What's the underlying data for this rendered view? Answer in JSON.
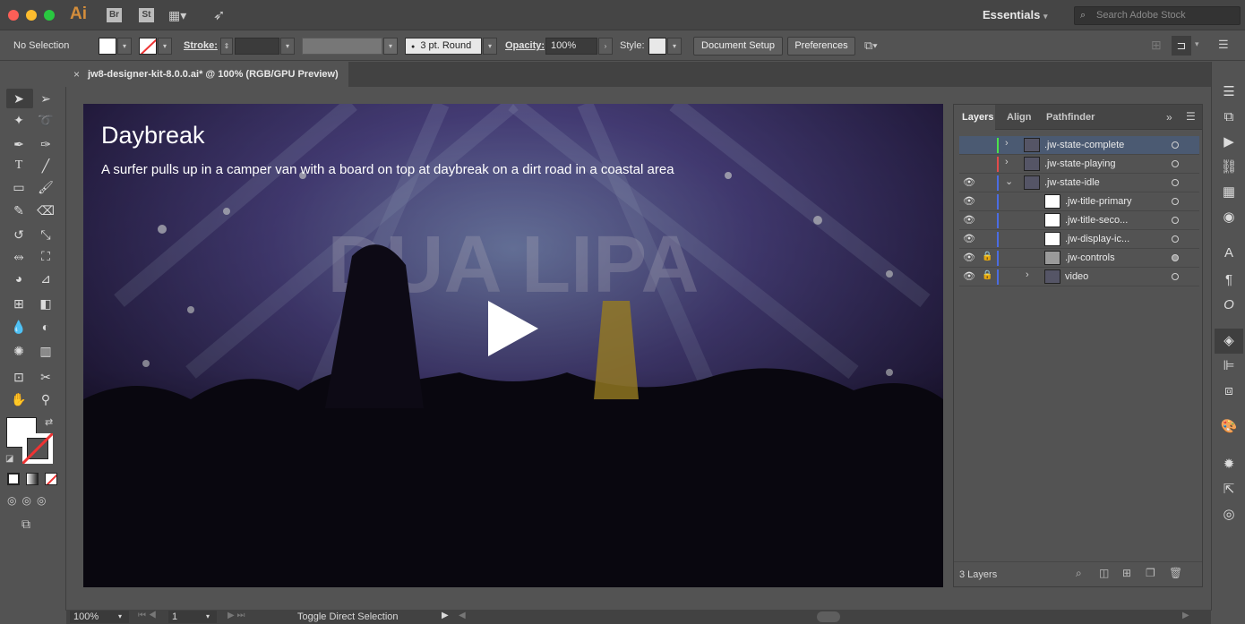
{
  "appbar": {
    "logo": "Ai",
    "bridge": "Br",
    "stock": "St",
    "workspace": "Essentials",
    "search_placeholder": "Search Adobe Stock"
  },
  "control": {
    "selection": "No Selection",
    "stroke_label": "Stroke:",
    "brush": "3 pt. Round",
    "opacity_label": "Opacity:",
    "opacity_value": "100%",
    "style_label": "Style:",
    "document_setup": "Document Setup",
    "preferences": "Preferences"
  },
  "document": {
    "tab_title": "jw8-designer-kit-8.0.0.ai* @ 100% (RGB/GPU Preview)",
    "close": "×"
  },
  "video": {
    "title": "Daybreak",
    "description": "A surfer pulls up in a camper van with a board on top at daybreak on a dirt road in a coastal area"
  },
  "layers_panel": {
    "tabs": [
      "Layers",
      "Align",
      "Pathfinder"
    ],
    "footer": "3 Layers",
    "rows": [
      {
        "name": ".jw-state-complete",
        "color": "#4be24b"
      },
      {
        "name": ".jw-state-playing",
        "color": "#e24b4b"
      },
      {
        "name": ".jw-state-idle",
        "color": "#4b6ce2"
      },
      {
        "name": ".jw-title-primary",
        "color": "#4b6ce2"
      },
      {
        "name": ".jw-title-seco...",
        "color": "#4b6ce2"
      },
      {
        "name": ".jw-display-ic...",
        "color": "#4b6ce2"
      },
      {
        "name": ".jw-controls",
        "color": "#4b6ce2"
      },
      {
        "name": "video",
        "color": "#4b6ce2"
      }
    ]
  },
  "status": {
    "zoom": "100%",
    "artboard": "1",
    "tool": "Toggle Direct Selection"
  }
}
